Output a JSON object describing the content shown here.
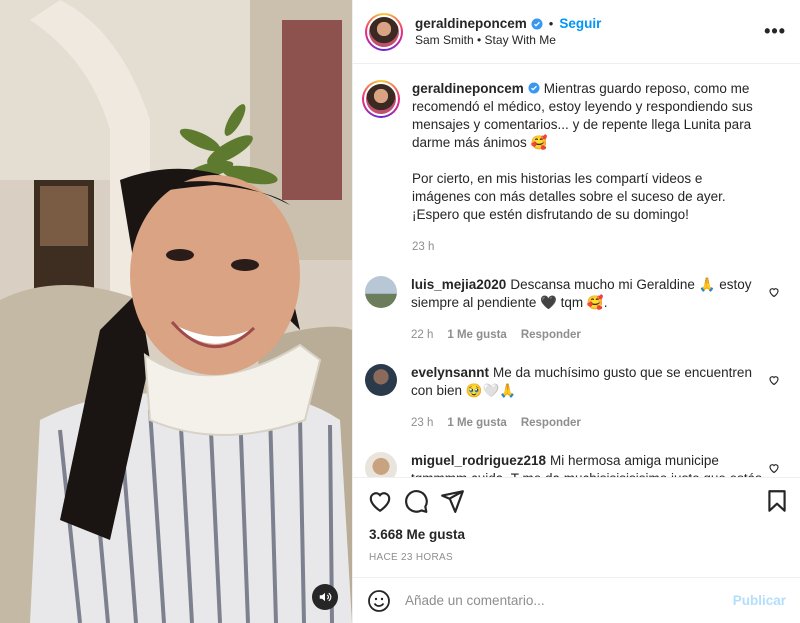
{
  "post": {
    "username": "geraldineponcem",
    "follow_label": "Seguir",
    "dot": "•",
    "song": "Sam Smith • Stay With Me",
    "more": "•••",
    "caption": {
      "text1": "Mientras guardo reposo, como me recomendó el médico, estoy leyendo y respondiendo sus mensajes y comentarios... y de repente llega Lunita para darme más ánimos 🥰",
      "text2": "Por cierto, en mis historias les compartí videos e imágenes con más detalles sobre el suceso de ayer. ¡Espero que estén disfrutando de su domingo!",
      "time": "23 h"
    }
  },
  "comments": [
    {
      "user": "luis_mejia2020",
      "text": "Descansa mucho mi Geraldine 🙏 estoy siempre al pendiente 🖤 tqm 🥰.",
      "time": "22 h",
      "likes": "1 Me gusta",
      "reply": "Responder"
    },
    {
      "user": "evelynsannt",
      "text": "Me da muchísimo gusto que se encuentren con bien 🥹🤍🙏",
      "time": "23 h",
      "likes": "1 Me gusta",
      "reply": "Responder"
    },
    {
      "user": "miguel_rodriguez218",
      "text": "Mi hermosa amiga municipe tqmmmm cuida_T me da muchisisisisisimo justo que estás bien y no fueron cosas más graves un saludo muy afectuoso para esa",
      "time": "",
      "likes": "",
      "reply": ""
    }
  ],
  "footer": {
    "likes": "3.668 Me gusta",
    "ago": "HACE 23 HORAS",
    "placeholder": "Añade un comentario...",
    "post_label": "Publicar"
  },
  "icons": {
    "verified": "verified-badge-icon",
    "heart": "heart-icon",
    "comment": "comment-icon",
    "share": "share-icon",
    "save": "bookmark-icon",
    "emoji": "emoji-icon",
    "audio": "speaker-icon"
  },
  "colors": {
    "accent": "#0095f6",
    "verified": "#3897f0",
    "muted": "#8e8e8e",
    "disabled_post": "#b2dffc"
  }
}
